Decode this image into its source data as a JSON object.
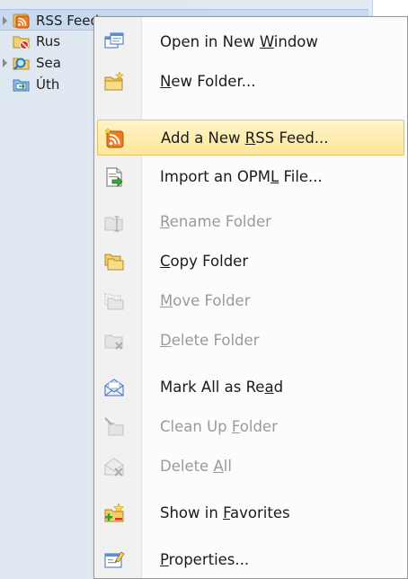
{
  "folder_tree": [
    {
      "label": "RSS Feeds",
      "icon": "rss-folder-icon",
      "expandable": true,
      "selected": true
    },
    {
      "label": "Rus",
      "icon": "junk-folder-icon",
      "expandable": false,
      "selected": false
    },
    {
      "label": "Sea",
      "icon": "search-folder-icon",
      "expandable": true,
      "selected": false
    },
    {
      "label": "Úth",
      "icon": "outbox-folder-icon",
      "expandable": false,
      "selected": false
    }
  ],
  "context_menu": {
    "items": [
      {
        "pre": "Open in New ",
        "key": "W",
        "post": "indow",
        "icon": "open-new-window-icon",
        "enabled": true,
        "hover": false
      },
      {
        "pre": "",
        "key": "N",
        "post": "ew Folder...",
        "icon": "new-folder-icon",
        "enabled": true,
        "hover": false
      },
      {
        "pre": "Add a New ",
        "key": "R",
        "post": "SS Feed...",
        "icon": "add-rss-feed-icon",
        "enabled": true,
        "hover": true
      },
      {
        "pre": "Import an OPM",
        "key": "L",
        "post": " File...",
        "icon": "import-opml-icon",
        "enabled": true,
        "hover": false
      },
      {
        "pre": "",
        "key": "R",
        "post": "ename Folder",
        "icon": "rename-folder-icon",
        "enabled": false,
        "hover": false
      },
      {
        "pre": "",
        "key": "C",
        "post": "opy Folder",
        "icon": "copy-folder-icon",
        "enabled": true,
        "hover": false
      },
      {
        "pre": "",
        "key": "M",
        "post": "ove Folder",
        "icon": "move-folder-icon",
        "enabled": false,
        "hover": false
      },
      {
        "pre": "",
        "key": "D",
        "post": "elete Folder",
        "icon": "delete-folder-icon",
        "enabled": false,
        "hover": false
      },
      {
        "pre": "Mark All as Re",
        "key": "a",
        "post": "d",
        "icon": "mark-all-read-icon",
        "enabled": true,
        "hover": false
      },
      {
        "pre": "Clean Up ",
        "key": "F",
        "post": "older",
        "icon": "clean-up-folder-icon",
        "enabled": false,
        "hover": false
      },
      {
        "pre": "Delete ",
        "key": "A",
        "post": "ll",
        "icon": "delete-all-icon",
        "enabled": false,
        "hover": false
      },
      {
        "pre": "Show in ",
        "key": "F",
        "post": "avorites",
        "icon": "show-in-favorites-icon",
        "enabled": true,
        "hover": false
      },
      {
        "pre": "",
        "key": "P",
        "post": "roperties...",
        "icon": "properties-icon",
        "enabled": true,
        "hover": false
      }
    ]
  },
  "colors": {
    "hover_fill": "#fde69b",
    "hover_border": "#e5c365",
    "disabled_text": "#9a9a9a",
    "rss_orange": "#f07b1e"
  }
}
